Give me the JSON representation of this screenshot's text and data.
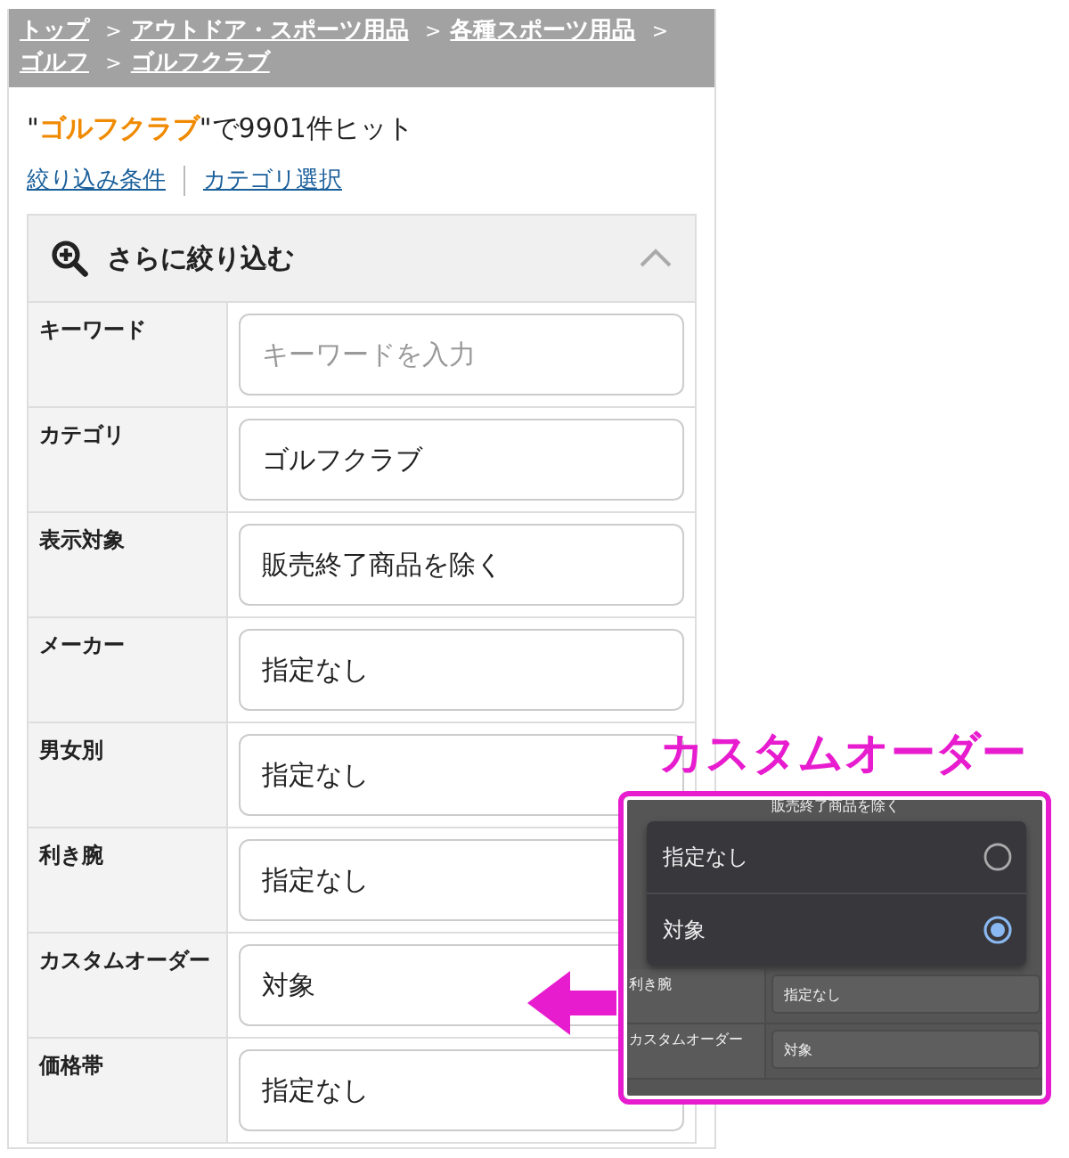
{
  "breadcrumb": [
    {
      "label": "トップ",
      "separator": ">"
    },
    {
      "label": "アウトドア・スポーツ用品",
      "separator": ">"
    },
    {
      "label": "各種スポーツ用品",
      "separator": ">"
    },
    {
      "label": "ゴルフ",
      "separator": ">"
    },
    {
      "label": "ゴルフクラブ"
    }
  ],
  "result": {
    "open_quote": "\"",
    "query": "ゴルフクラブ",
    "rest": "\"で9901件ヒット"
  },
  "links": [
    "絞り込み条件",
    "カテゴリ選択"
  ],
  "filter": {
    "title": "さらに絞り込む",
    "expanded": true,
    "rows": [
      {
        "label": "キーワード",
        "placeholder": "キーワードを入力"
      },
      {
        "label": "カテゴリ",
        "value": "ゴルフクラブ"
      },
      {
        "label": "表示対象",
        "value": "販売終了商品を除く"
      },
      {
        "label": "メーカー",
        "value": "指定なし"
      },
      {
        "label": "男女別",
        "value": "指定なし"
      },
      {
        "label": "利き腕",
        "value": "指定なし"
      },
      {
        "label": "カスタムオーダー",
        "value": "対象"
      },
      {
        "label": "価格帯",
        "value": "指定なし"
      }
    ]
  },
  "callout": {
    "title": "カスタムオーダー",
    "preview_rows": [
      {
        "value": "販売終了商品を除く"
      },
      {
        "label": "利き腕",
        "value": "指定なし"
      },
      {
        "label": "カスタムオーダー",
        "value": "対象"
      }
    ],
    "options": [
      {
        "label": "指定なし",
        "selected": false
      },
      {
        "label": "対象",
        "selected": true
      }
    ]
  }
}
